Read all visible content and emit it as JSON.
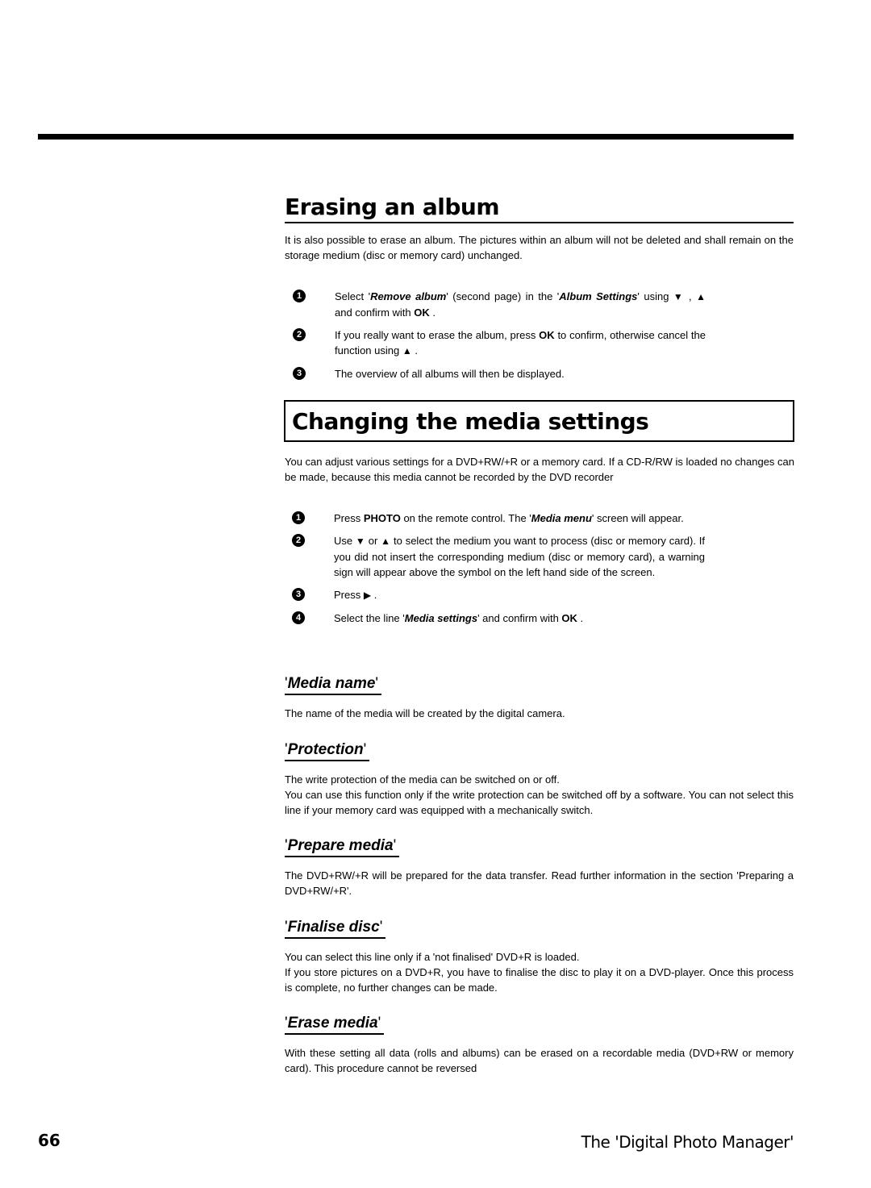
{
  "sections": {
    "erasing": {
      "title": "Erasing an album",
      "intro": "It is also possible to erase an album. The pictures within an album will not be deleted and shall remain on the storage medium (disc or memory card) unchanged.",
      "steps": [
        {
          "num": "1",
          "parts": [
            "Select '",
            "Remove album",
            "' (second page) in the '",
            "Album Settings",
            "' using ",
            "▼",
            " , ",
            "▲",
            " and confirm with ",
            "OK",
            " ."
          ]
        },
        {
          "num": "2",
          "parts": [
            "If you really want to erase the album, press ",
            "OK",
            " to confirm, otherwise cancel the function using ",
            "▲",
            " ."
          ]
        },
        {
          "num": "3",
          "text": "The overview of all albums will then be displayed."
        }
      ]
    },
    "media": {
      "title": "Changing the media settings",
      "intro": "You can adjust various settings for a DVD+RW/+R or a memory card. If a CD-R/RW is loaded no changes can be made, because this media cannot be recorded by the DVD recorder",
      "steps": [
        {
          "num": "1",
          "parts": [
            "Press ",
            "PHOTO",
            " on the remote control. The '",
            "Media menu",
            "' screen will appear."
          ]
        },
        {
          "num": "2",
          "parts": [
            "Use ",
            "▼",
            " or ",
            "▲",
            " to select the medium you want to process (disc or memory card). If you did not insert the corresponding medium (disc or memory card), a warning sign will appear above the symbol on the left hand side of the screen."
          ]
        },
        {
          "num": "3",
          "parts": [
            "Press ",
            "▶",
            " ."
          ]
        },
        {
          "num": "4",
          "parts": [
            "Select the line '",
            "Media settings",
            "' and confirm with ",
            "OK",
            " ."
          ]
        }
      ]
    },
    "subsections": [
      {
        "title": "Media name",
        "paragraphs": [
          "The name of the media will be created by the digital camera."
        ]
      },
      {
        "title": "Protection",
        "paragraphs": [
          "The write protection of the media can be switched on or off.",
          "You can use this function only if the write protection can be switched off by a software. You can not select this line if your memory card was equipped with a mechanically switch."
        ]
      },
      {
        "title": "Prepare media",
        "paragraphs": [
          "The DVD+RW/+R will be prepared for the data transfer. Read further information in the section 'Preparing a DVD+RW/+R'."
        ]
      },
      {
        "title": "Finalise disc",
        "paragraphs": [
          "You can select this line only if a 'not finalised' DVD+R is loaded.",
          "If you store pictures on a DVD+R, you have to finalise the disc to play it on a DVD-player. Once this process is complete, no further changes can be made."
        ]
      },
      {
        "title": "Erase media",
        "paragraphs": [
          "With these setting all data (rolls and albums) can be erased on a recordable media (DVD+RW or memory card). This procedure cannot be reversed"
        ]
      }
    ]
  },
  "footer": {
    "page_number": "66",
    "chapter_title": "The 'Digital Photo Manager'"
  },
  "quote": "'"
}
